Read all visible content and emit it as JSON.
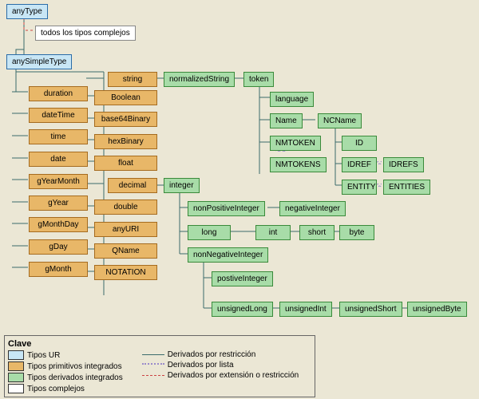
{
  "roots": {
    "anyType": "anyType",
    "complex": "todos los tipos complejos",
    "anySimpleType": "anySimpleType"
  },
  "primitives": {
    "col1": [
      "duration",
      "dateTime",
      "time",
      "date",
      "gYearMonth",
      "gYear",
      "gMonthDay",
      "gDay",
      "gMonth"
    ],
    "col2": [
      "string",
      "Boolean",
      "base64Binary",
      "hexBinary",
      "float",
      "decimal",
      "double",
      "anyURI",
      "QName",
      "NOTATION"
    ]
  },
  "derived": {
    "normalizedString": "normalizedString",
    "token": "token",
    "language": "language",
    "Name": "Name",
    "NMTOKEN": "NMTOKEN",
    "NMTOKENS": "NMTOKENS",
    "NCName": "NCName",
    "ID": "ID",
    "IDREF": "IDREF",
    "IDREFS": "IDREFS",
    "ENTITY": "ENTITY",
    "ENTITIES": "ENTITIES",
    "integer": "integer",
    "nonPositiveInteger": "nonPositiveInteger",
    "negativeInteger": "negativeInteger",
    "long": "long",
    "int": "int",
    "short": "short",
    "byte": "byte",
    "nonNegativeInteger": "nonNegativeInteger",
    "postiveInteger": "postiveInteger",
    "unsignedLong": "unsignedLong",
    "unsignedInt": "unsignedInt",
    "unsignedShort": "unsignedShort",
    "unsignedByte": "unsignedByte"
  },
  "legend": {
    "title": "Clave",
    "ur": "Tipos UR",
    "prim": "Tipos primitivos integrados",
    "derv": "Tipos derivados integrados",
    "cplx": "Tipos complejos",
    "restr": "Derivados por restricción",
    "list": "Derivados por lista",
    "ext": "Derivados por extensión o restricción"
  }
}
